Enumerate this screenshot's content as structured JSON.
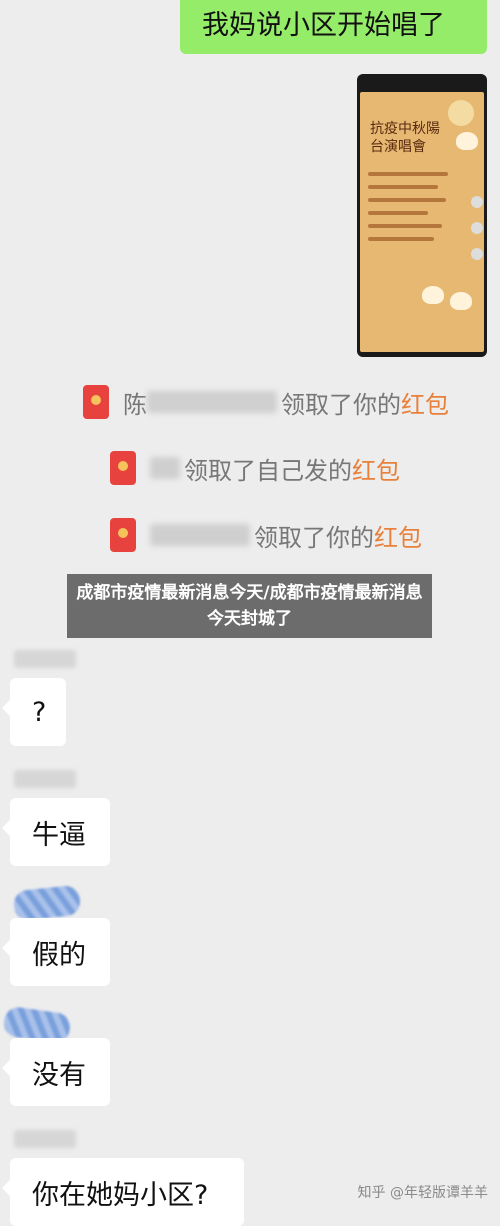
{
  "chat": {
    "outgoing_message": "我妈说小区开始唱了",
    "incoming_messages": [
      "?",
      "牛逼",
      "假的",
      "没有",
      "你在她妈小区?"
    ]
  },
  "shared_screenshot": {
    "poster_title": "抗疫中秋陽台演唱會"
  },
  "red_packets": [
    {
      "prefix": "陈",
      "action": "领取了你的",
      "keyword": "红包"
    },
    {
      "prefix": "",
      "action": "领取了自己发的",
      "keyword": "红包"
    },
    {
      "prefix": "",
      "action": "领取了你的",
      "keyword": "红包"
    }
  ],
  "banner": {
    "text": "成都市疫情最新消息今天/成都市疫情最新消息今天封城了"
  },
  "watermark": {
    "text": "知乎 @年轻版谭羊羊"
  },
  "colors": {
    "outgoing_bubble": "#95ec69",
    "incoming_bubble": "#ffffff",
    "background": "#ededed",
    "red_packet_keyword": "#e8803a"
  }
}
